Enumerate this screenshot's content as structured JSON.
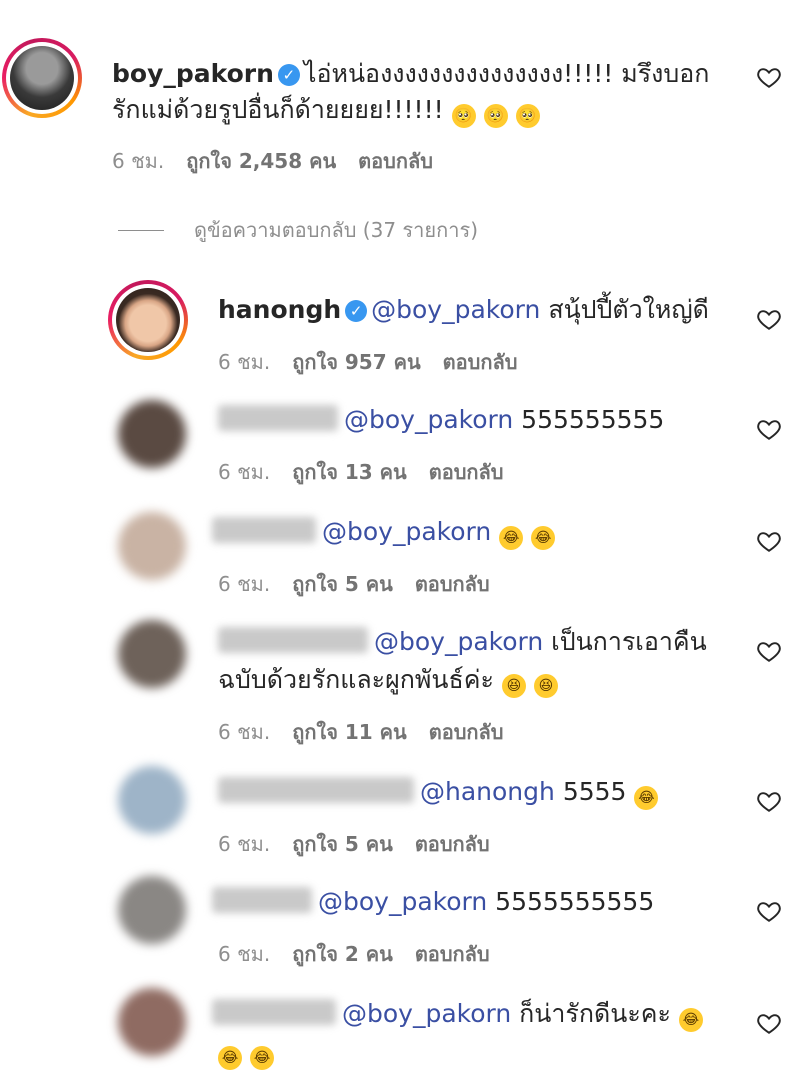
{
  "comments": [
    {
      "username": "boy_pakorn",
      "verified": true,
      "text_line1": "ไอ่หน่องงงงงงงงงงงงงงง!!!!! มรึงบอก",
      "text_line2": "รักแม่ด้วยรูปอื่นก็ด้ายยยย!!!!!!",
      "emojis": [
        "🥺",
        "🥺",
        "🥺"
      ],
      "time": "6 ชม.",
      "likes": "ถูกใจ 2,458 คน",
      "reply": "ตอบกลับ"
    }
  ],
  "view_replies": "ดูข้อความตอบกลับ (37 รายการ)",
  "replies": [
    {
      "username": "hanongh",
      "verified": true,
      "mention": "@boy_pakorn",
      "text": "สนุ้ปปี้ตัวใหญ่ดี",
      "time": "6 ชม.",
      "likes": "ถูกใจ 957 คน",
      "reply": "ตอบกลับ"
    },
    {
      "mention": "@boy_pakorn",
      "text": "555555555",
      "time": "6 ชม.",
      "likes": "ถูกใจ 13 คน",
      "reply": "ตอบกลับ"
    },
    {
      "mention": "@boy_pakorn",
      "text": "",
      "emojis": [
        "😂",
        "😂"
      ],
      "time": "6 ชม.",
      "likes": "ถูกใจ 5 คน",
      "reply": "ตอบกลับ"
    },
    {
      "mention": "@boy_pakorn",
      "text": "เป็นการเอาคืน",
      "text_line2": "ฉบับด้วยรักและผูกพันธ์ค่ะ",
      "emojis": [
        "😆",
        "😆"
      ],
      "time": "6 ชม.",
      "likes": "ถูกใจ 11 คน",
      "reply": "ตอบกลับ"
    },
    {
      "mention": "@hanongh",
      "text": "5555",
      "emojis": [
        "😂"
      ],
      "time": "6 ชม.",
      "likes": "ถูกใจ 5 คน",
      "reply": "ตอบกลับ"
    },
    {
      "mention": "@boy_pakorn",
      "text": "5555555555",
      "time": "6 ชม.",
      "likes": "ถูกใจ 2 คน",
      "reply": "ตอบกลับ"
    },
    {
      "mention": "@boy_pakorn",
      "text": "ก็น่ารักดีนะคะ",
      "emojis": [
        "😂",
        "😂",
        "😂"
      ]
    }
  ],
  "colors": {
    "mention": "#3a4fa3",
    "meta": "#8e8e8e",
    "verified": "#3897f0"
  },
  "icons": {
    "like": "heart-outline-icon",
    "verified": "verified-badge-icon"
  }
}
